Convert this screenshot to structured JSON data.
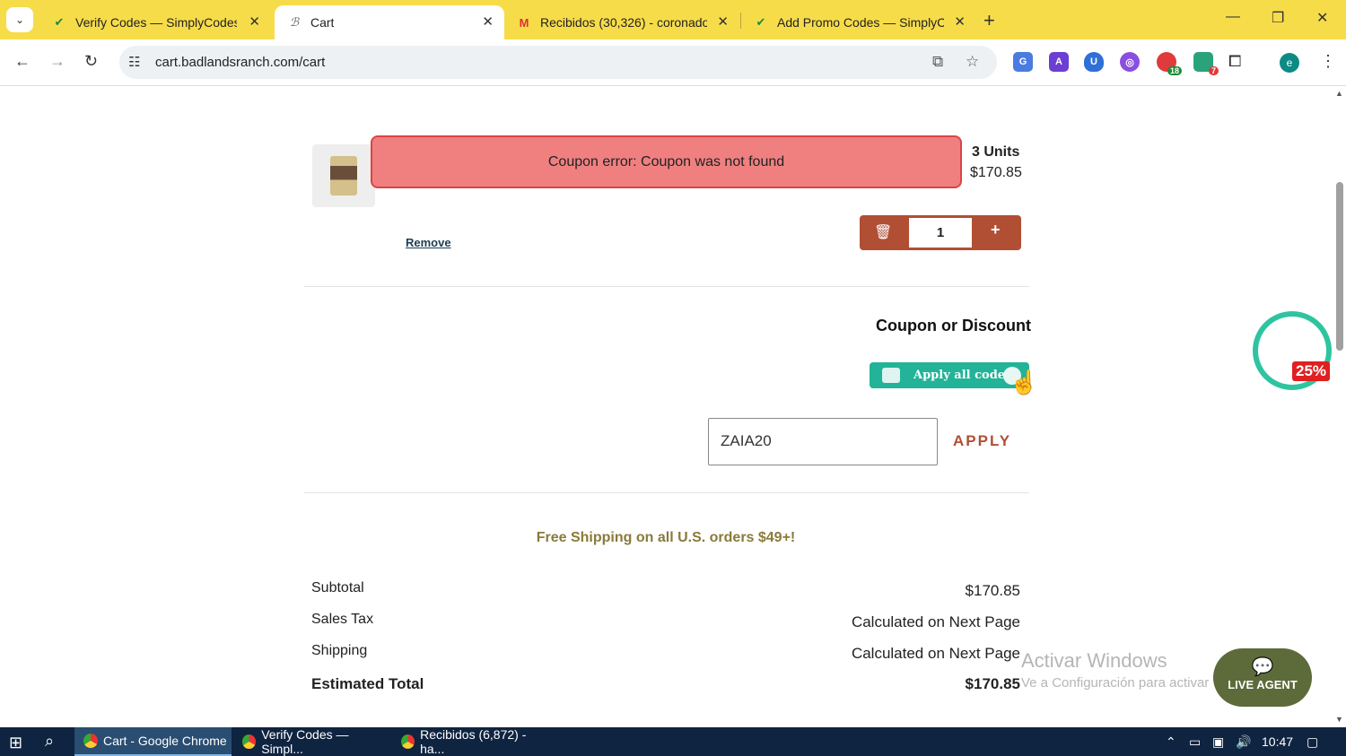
{
  "browser": {
    "tabs": [
      {
        "title": "Verify Codes — SimplyCodes",
        "icon": "simplycodes-icon"
      },
      {
        "title": "Cart",
        "icon": "badlands-icon"
      },
      {
        "title": "Recibidos (30,326) - coronadoe",
        "icon": "gmail-icon"
      },
      {
        "title": "Add Promo Codes — SimplyCo",
        "icon": "simplycodes-icon"
      }
    ],
    "active_tab": 1,
    "url": "cart.badlandsranch.com/cart",
    "extension_badges": {
      "ext1": "18",
      "ext2": "7"
    },
    "profile_initial": "e"
  },
  "cart": {
    "error_message": "Coupon error: Coupon was not found",
    "item": {
      "units": "3 Units",
      "price": "$170.85",
      "quantity": "1",
      "remove_label": "Remove"
    },
    "coupon": {
      "title": "Coupon or Discount",
      "apply_all_label": "Apply all codes",
      "input_value": "ZAIA20",
      "apply_label": "APPLY"
    },
    "free_shipping": "Free Shipping on all U.S. orders $49+!",
    "summary": {
      "subtotal_label": "Subtotal",
      "subtotal_value": "$170.85",
      "tax_label": "Sales Tax",
      "tax_value": "Calculated on Next Page",
      "shipping_label": "Shipping",
      "shipping_value": "Calculated on Next Page",
      "total_label": "Estimated Total",
      "total_value": "$170.85"
    }
  },
  "widgets": {
    "promo_percent": "25%",
    "live_agent_label": "LIVE AGENT",
    "watermark_title": "Activar Windows",
    "watermark_sub": "Ve a Configuración para activar Windows."
  },
  "taskbar": {
    "items": [
      "Cart - Google Chrome",
      "Verify Codes — Simpl...",
      "Recibidos (6,872) - ha..."
    ],
    "clock": "10:47"
  },
  "colors": {
    "tabstrip": "#f7dc4a",
    "error_bg": "#f08080",
    "accent": "#b14f35",
    "apply_all": "#22b398"
  }
}
